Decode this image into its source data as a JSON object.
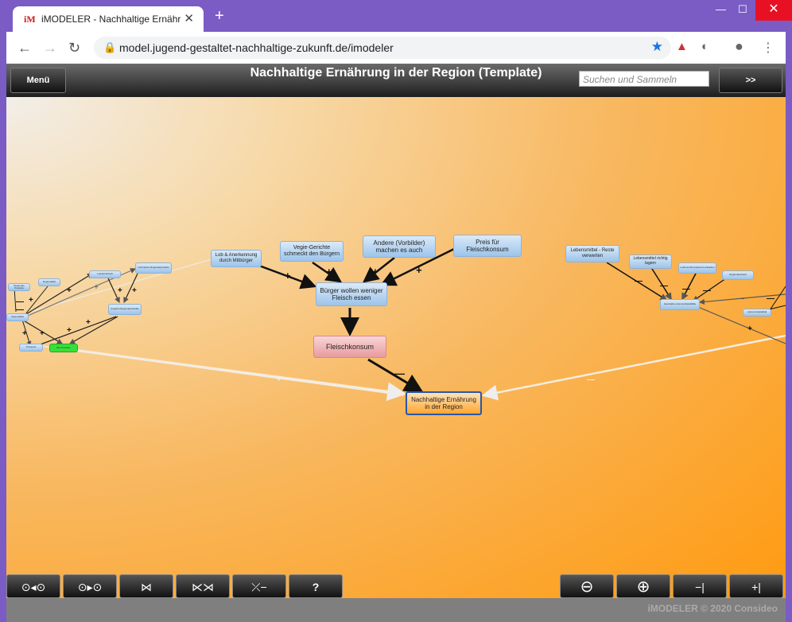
{
  "browser": {
    "tab_favicon": "iM",
    "tab_title": "iMODELER - Nachhaltige Ernähru",
    "tab_close": "✕",
    "new_tab": "+",
    "url": "model.jugend-gestaltet-nachhaltige-zukunft.de/imodeler",
    "min": "—",
    "max": "☐",
    "close": "✕"
  },
  "header": {
    "menu_label": "Menü",
    "title": "Nachhaltige Ernährung in der Region (Template)",
    "search_placeholder": "Suchen und Sammeln",
    "expand_label": ">>"
  },
  "nodes": {
    "target": "Nachhaltige Ernährung in der Region",
    "fleischkonsum": "Fleischkonsum",
    "buerger": "Bürger wollen weniger Fleisch essen",
    "lob": "Lob & Anerkennung durch Mitbürger",
    "vegie": "Vegie-Gerichte schmeckt den Bürgern",
    "andere": "Andere (Vorbilder) machen es auch",
    "preis": "Preis für Fleischkonsum",
    "lebensmittel_reste": "Lebensmittel - Reste verwerten",
    "lebensmittel_lagern": "Lebensmittel richtig lagern",
    "lebensmittel_passend": "Lebensmittel passend einkaufen",
    "regionaleinkauf": "Regionaleinkauf",
    "haushalte": "Haushalte Lebensmittelabfälle",
    "abfall": "Lebensmittelabfall",
    "lieferanten": "Lieferanten Regionalprodukte",
    "angebot": "Angebot Regionalprodukte",
    "left1": "Landwirtschaft",
    "left2": "Regionalität",
    "left3": "Regionale Produkte",
    "left4": "Saisonalität",
    "left5": "Transport",
    "left_green": "Bio-Produkte",
    "left_small": "Einkauf regional"
  },
  "signs": {
    "plus": "+",
    "minus": "—"
  },
  "toolbar": {
    "nav_back": "←",
    "nav_forward": "→",
    "reload": "↻",
    "lock": "🔒",
    "star": "★",
    "t1": "⊙◂⊙",
    "t2": "⊙▸⊙",
    "t3": "⋈",
    "t4": "⋉⋊",
    "t5": "⤫−",
    "help": "?",
    "zoom_out": "⊖",
    "zoom_in": "⊕",
    "depth_less": "−|",
    "depth_more": "+|"
  },
  "footer": {
    "copyright": "iMODELER © 2020 Consideo"
  }
}
